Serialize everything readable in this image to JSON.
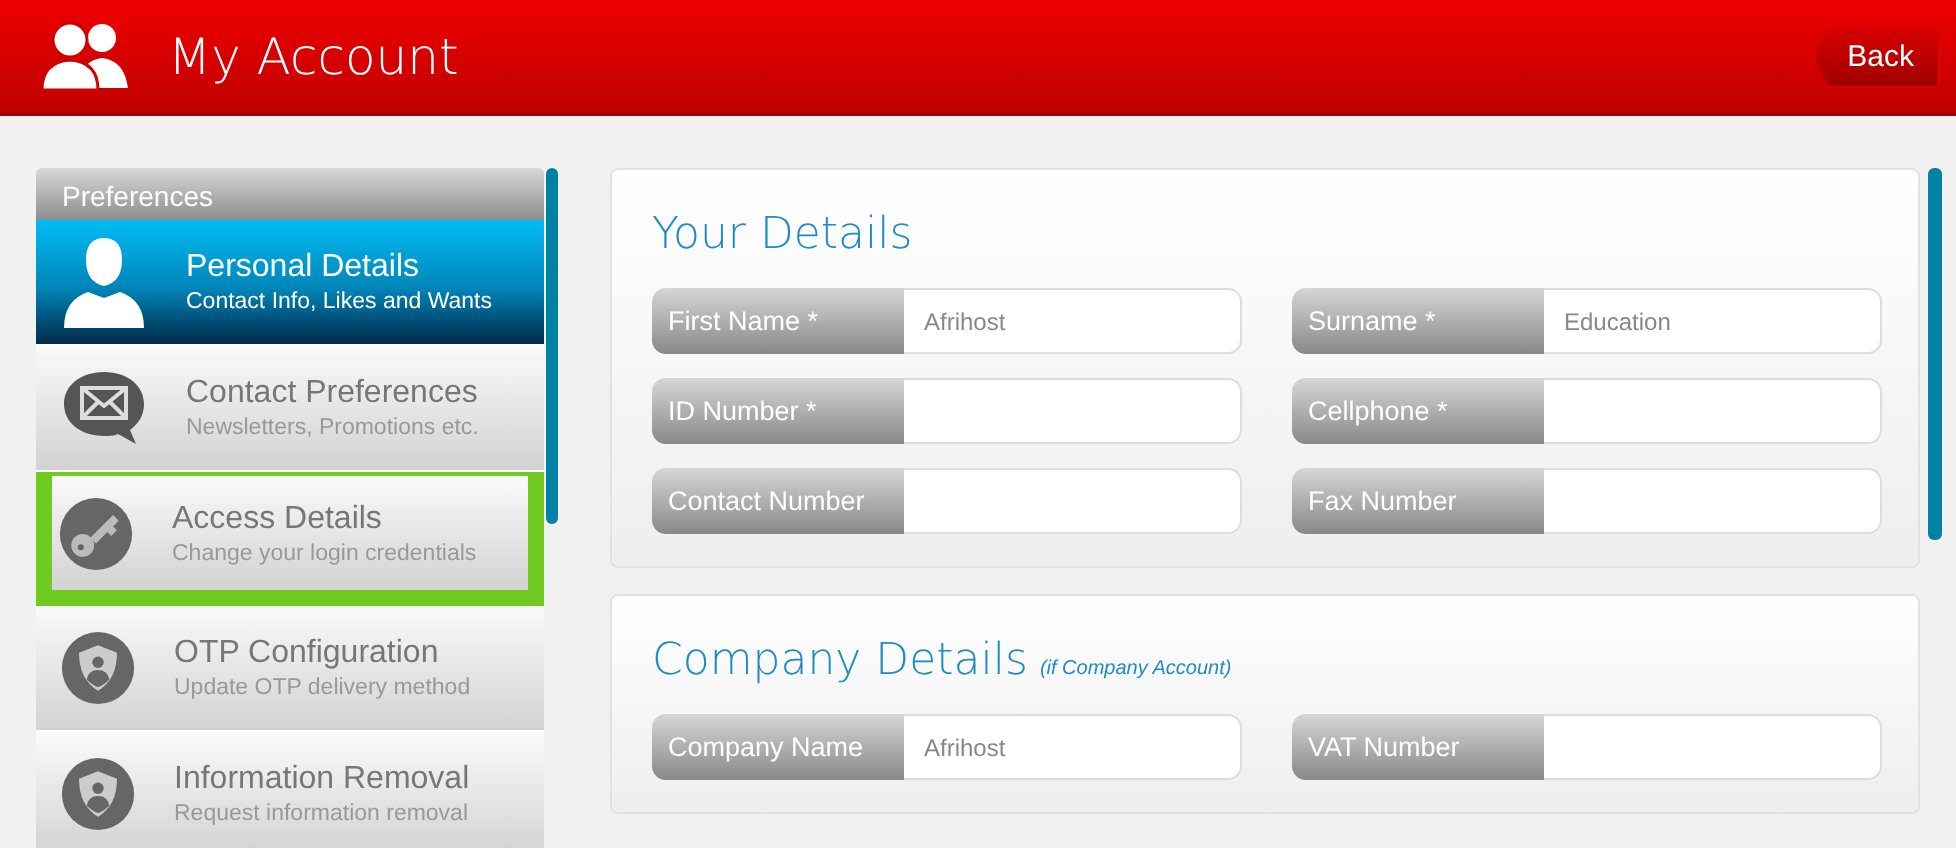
{
  "header": {
    "title": "My Account",
    "back_button": "Back"
  },
  "sidebar": {
    "heading": "Preferences",
    "items": [
      {
        "kind": "person",
        "title": "Personal Details",
        "subtitle": "Contact Info, Likes and Wants",
        "selected": true,
        "highlighted": false
      },
      {
        "kind": "envelope",
        "title": "Contact Preferences",
        "subtitle": "Newsletters, Promotions etc.",
        "selected": false,
        "highlighted": false
      },
      {
        "kind": "key",
        "title": "Access Details",
        "subtitle": "Change your login credentials",
        "selected": false,
        "highlighted": true
      },
      {
        "kind": "shield",
        "title": "OTP Configuration",
        "subtitle": "Update OTP delivery method",
        "selected": false,
        "highlighted": false
      },
      {
        "kind": "shield",
        "title": "Information Removal",
        "subtitle": "Request information removal",
        "selected": false,
        "highlighted": false
      }
    ]
  },
  "sections": [
    {
      "title": "Your Details",
      "fields": [
        {
          "label": "First Name *",
          "value": "Afrihost"
        },
        {
          "label": "Surname *",
          "value": "Education"
        },
        {
          "label": "ID Number *"
        },
        {
          "label": "Cellphone *"
        },
        {
          "label": "Contact Number"
        },
        {
          "label": "Fax Number"
        }
      ]
    },
    {
      "title": "Company Details",
      "note": "(if Company Account)",
      "fields": [
        {
          "label": "Company Name",
          "value": "Afrihost"
        },
        {
          "label": "VAT Number"
        }
      ]
    }
  ]
}
